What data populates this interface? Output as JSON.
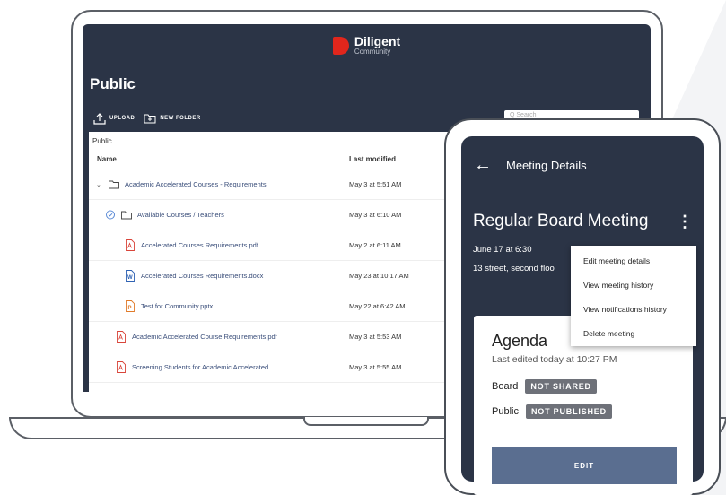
{
  "laptop": {
    "brand": {
      "name": "Diligent",
      "sub": "Community"
    },
    "page_title": "Public",
    "toolbar": {
      "upload_label": "UPLOAD",
      "new_folder_label": "NEW FOLDER"
    },
    "search_placeholder": "Q Search",
    "breadcrumb": "Public",
    "columns": {
      "name": "Name",
      "modified": "Last modified"
    },
    "rows": [
      {
        "name": "Academic Accelerated Courses - Requirements",
        "modified": "May 3  at 5:51 AM",
        "icon": "folder-icon"
      },
      {
        "name": "Available Courses / Teachers",
        "modified": "May 3  at 6:10 AM",
        "icon": "folder-icon"
      },
      {
        "name": "Accelerated Courses Requirements.pdf",
        "modified": "May 2  at 6:11 AM",
        "icon": "pdf-icon"
      },
      {
        "name": "Accelerated Courses Requirements.docx",
        "modified": "May 23  at 10:17 AM",
        "icon": "word-icon"
      },
      {
        "name": "Test for Community.pptx",
        "modified": "May 22  at 6:42 AM",
        "icon": "pptx-icon"
      },
      {
        "name": "Academic Accelerated Course Requirements.pdf",
        "modified": "May 3  at 5:53 AM",
        "icon": "pdf-icon"
      },
      {
        "name": "Screening Students for Academic Accelerated...",
        "modified": "May 3  at 5:55 AM",
        "icon": "pdf-icon"
      }
    ]
  },
  "phone": {
    "header_title": "Meeting Details",
    "meeting_title": "Regular Board Meeting",
    "date": "June 17 at 6:30",
    "location": "13 street, second floo",
    "menu": [
      "Edit meeting details",
      "View meeting history",
      "View notifications history",
      "Delete meeting"
    ],
    "agenda": {
      "title": "Agenda",
      "subtitle": "Last edited today at 10:27 PM",
      "board_label": "Board",
      "board_status": "NOT SHARED",
      "public_label": "Public",
      "public_status": "NOT PUBLISHED",
      "edit_label": "EDIT"
    }
  },
  "colors": {
    "navy": "#2b3446",
    "brand_red": "#e1261c",
    "button": "#5a6e90",
    "badge": "#6e7179"
  }
}
